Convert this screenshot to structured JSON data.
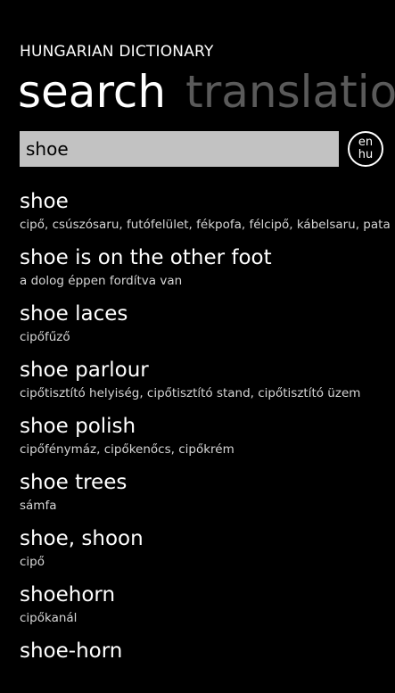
{
  "app": {
    "title": "HUNGARIAN DICTIONARY"
  },
  "pivot": {
    "items": [
      "search",
      "translation"
    ]
  },
  "search": {
    "value": "shoe",
    "placeholder": ""
  },
  "language_toggle": {
    "from": "en",
    "to": "hu"
  },
  "results": [
    {
      "term": "shoe",
      "translation": "cipő, csúszósaru, futófelület, fékpofa, félcipő, kábelsaru, pata"
    },
    {
      "term": "shoe is on the other foot",
      "translation": "a dolog éppen fordítva van"
    },
    {
      "term": "shoe laces",
      "translation": "cipőfűző"
    },
    {
      "term": "shoe parlour",
      "translation": "cipőtisztító helyiség, cipőtisztító stand, cipőtisztító üzem"
    },
    {
      "term": "shoe polish",
      "translation": "cipőfénymáz, cipőkenőcs, cipőkrém"
    },
    {
      "term": "shoe trees",
      "translation": "sámfa"
    },
    {
      "term": "shoe, shoon",
      "translation": "cipő"
    },
    {
      "term": "shoehorn",
      "translation": "cipőkanál"
    },
    {
      "term": "shoe-horn",
      "translation": ""
    }
  ],
  "colors": {
    "background": "#000000",
    "text": "#ffffff",
    "inactive_pivot": "#5a5a5a",
    "search_box": "#c2c2c2"
  }
}
